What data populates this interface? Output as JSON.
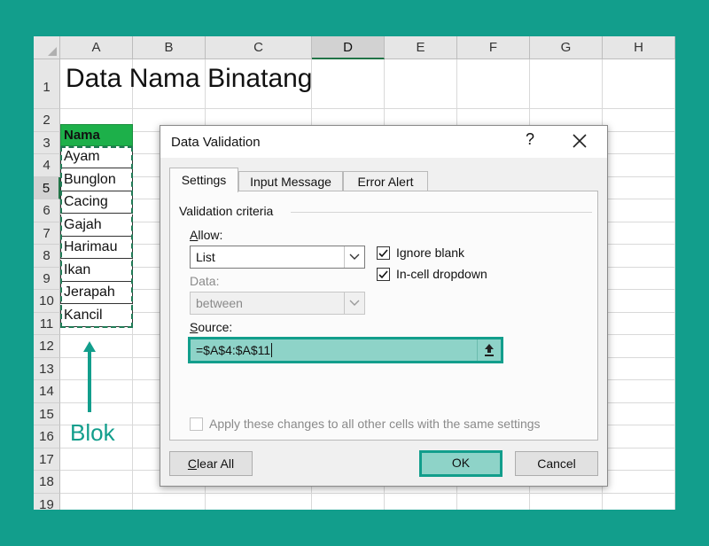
{
  "sheet": {
    "columns": [
      "A",
      "B",
      "C",
      "D",
      "E",
      "F",
      "G",
      "H"
    ],
    "selected_column": "D",
    "rows": [
      "1",
      "2",
      "3",
      "4",
      "5",
      "6",
      "7",
      "8",
      "9",
      "10",
      "11",
      "12",
      "13",
      "14",
      "15",
      "16",
      "17",
      "18",
      "19"
    ],
    "selected_row": "5",
    "title": "Data Nama Binatang",
    "header": "Nama",
    "animals": [
      "Ayam",
      "Bunglon",
      "Cacing",
      "Gajah",
      "Harimau",
      "Ikan",
      "Jerapah",
      "Kancil"
    ]
  },
  "annotation": {
    "label": "Blok",
    "color": "#129e8c"
  },
  "dialog": {
    "title": "Data Validation",
    "help_glyph": "?",
    "tabs": [
      "Settings",
      "Input Message",
      "Error Alert"
    ],
    "active_tab": "Settings",
    "group_title": "Validation criteria",
    "allow_label": "Allow:",
    "allow_value": "List",
    "data_label": "Data:",
    "data_value": "between",
    "ignore_blank_label": "Ignore blank",
    "ignore_blank_checked": true,
    "in_cell_dropdown_label": "In-cell dropdown",
    "in_cell_dropdown_checked": true,
    "source_label": "Source:",
    "source_value": "=$A$4:$A$11",
    "apply_all_label": "Apply these changes to all other cells with the same settings",
    "apply_all_checked": false,
    "clear_all_label": "Clear All",
    "ok_label": "OK",
    "cancel_label": "Cancel"
  },
  "colors": {
    "background": "#129e8c",
    "header_fill": "#1db04a",
    "highlight": "#8ed3c8",
    "excel_green": "#217346"
  }
}
